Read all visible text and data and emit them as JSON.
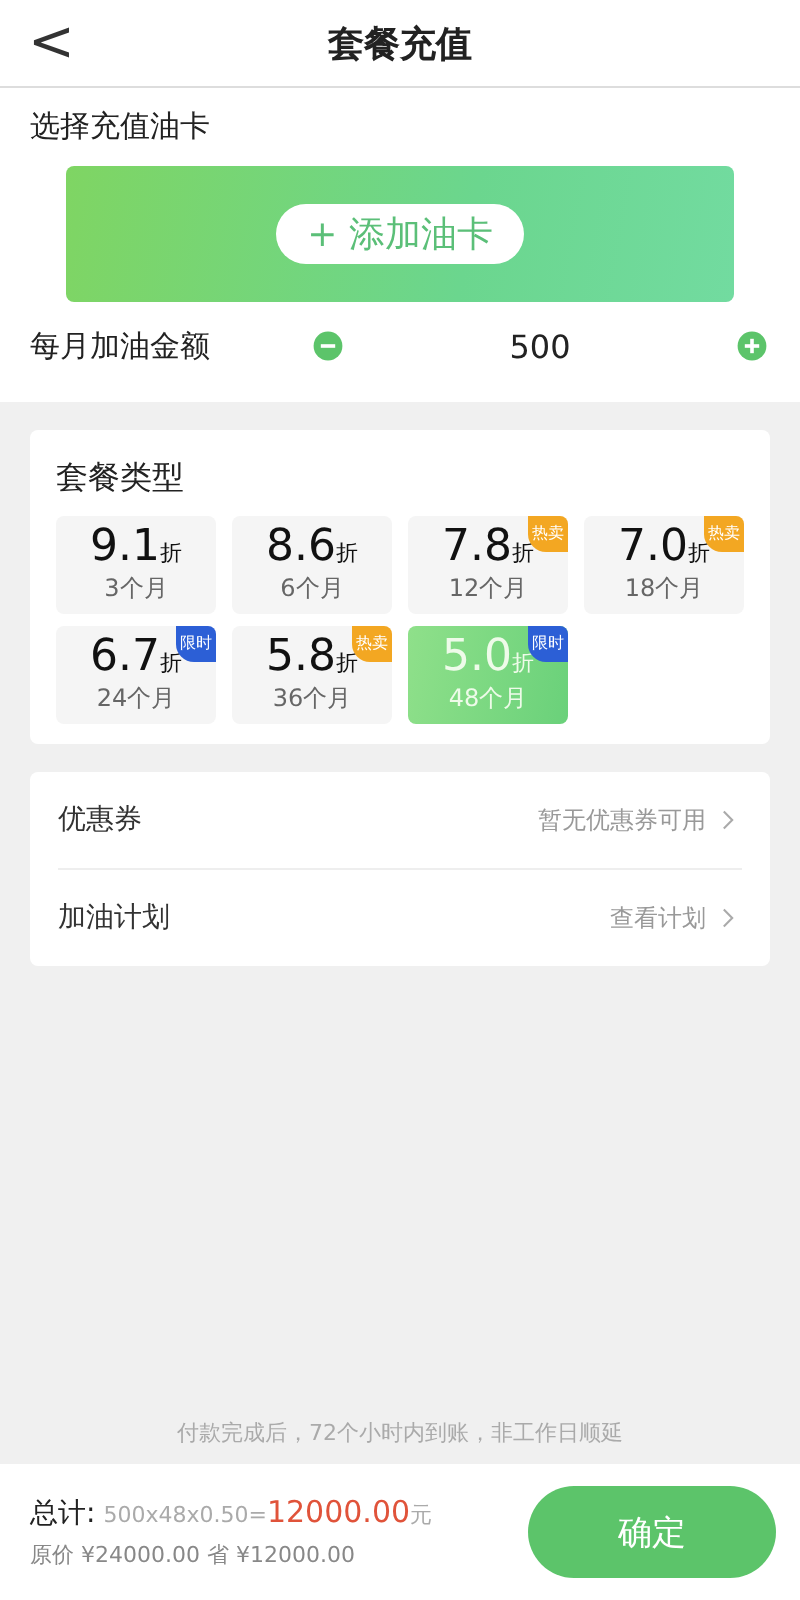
{
  "header": {
    "back": "<",
    "title": "套餐充值"
  },
  "card_section": {
    "label": "选择充值油卡",
    "add_button": "+ 添加油卡"
  },
  "amount": {
    "label": "每月加油金额",
    "value": "500"
  },
  "plans": {
    "title": "套餐类型",
    "items": [
      {
        "discount": "9.1",
        "unit": "折",
        "months": "3个月",
        "selected": false
      },
      {
        "discount": "8.6",
        "unit": "折",
        "months": "6个月",
        "selected": false
      },
      {
        "discount": "7.8",
        "unit": "折",
        "months": "12个月",
        "selected": false,
        "badge": {
          "kind": "hot",
          "text": "热卖"
        }
      },
      {
        "discount": "7.0",
        "unit": "折",
        "months": "18个月",
        "selected": false,
        "badge": {
          "kind": "hot",
          "text": "热卖"
        }
      },
      {
        "discount": "6.7",
        "unit": "折",
        "months": "24个月",
        "selected": false,
        "badge": {
          "kind": "limited",
          "text": "限时"
        }
      },
      {
        "discount": "5.8",
        "unit": "折",
        "months": "36个月",
        "selected": false,
        "badge": {
          "kind": "hot",
          "text": "热卖"
        }
      },
      {
        "discount": "5.0",
        "unit": "折",
        "months": "48个月",
        "selected": true,
        "badge": {
          "kind": "limited",
          "text": "限时"
        }
      }
    ]
  },
  "options": [
    {
      "label": "优惠券",
      "value": "暂无优惠券可用"
    },
    {
      "label": "加油计划",
      "value": "查看计划"
    }
  ],
  "note": "付款完成后，72个小时内到账，非工作日顺延",
  "footer": {
    "total_label": "总计:",
    "formula": "500x48x0.50=",
    "total": "12000.00",
    "currency": "元",
    "original": "原价 ¥24000.00 省 ¥12000.00",
    "confirm": "确定"
  }
}
